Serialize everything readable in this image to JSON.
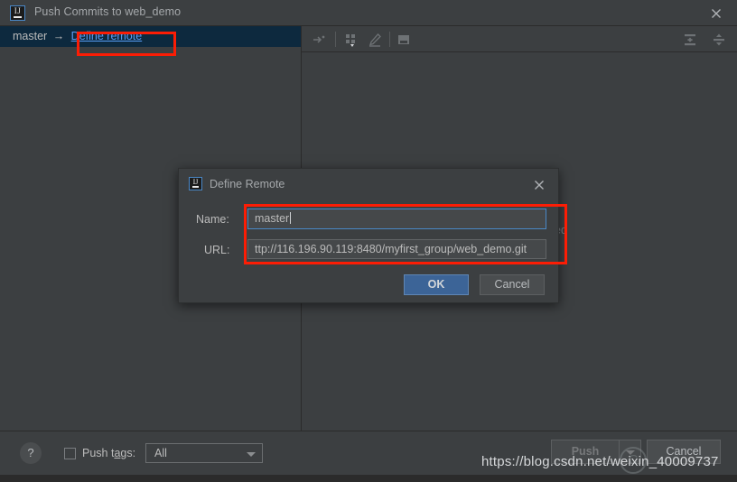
{
  "window": {
    "title": "Push Commits to web_demo",
    "logo_text": "IJ",
    "close_icon": "close-icon"
  },
  "toolbar": {
    "icons": [
      {
        "name": "collapse-arrow-icon",
        "label": ""
      },
      {
        "name": "grid-dropdown-icon",
        "label": ""
      },
      {
        "name": "edit-pencil-icon",
        "label": ""
      },
      {
        "name": "diff-view-icon",
        "label": ""
      },
      {
        "name": "expand-all-icon",
        "label": ""
      },
      {
        "name": "collapse-all-icon",
        "label": ""
      }
    ]
  },
  "left_pane": {
    "branch_row": {
      "source_branch": "master",
      "arrow": "→",
      "target_link": "Define remote"
    }
  },
  "right_pane": {
    "partial_commit_text": "ed"
  },
  "bottom_bar": {
    "help_label": "?",
    "push_tags_label_pre": "Push t",
    "push_tags_label_mnemonic": "a",
    "push_tags_label_post": "gs:",
    "push_tags_checked": false,
    "tags_combo_value": "All",
    "push_label": "Push",
    "push_dropdown": "chevron-down-icon",
    "cancel_label": "Cancel"
  },
  "modal": {
    "title": "Define Remote",
    "logo_text": "IJ",
    "close_icon": "close-icon",
    "name_label": "Name:",
    "name_value": "master",
    "url_label": "URL:",
    "url_value": "ttp://116.196.90.119:8480/myfirst_group/web_demo.git",
    "ok_label": "OK",
    "cancel_label": "Cancel"
  },
  "annotations": {
    "highlight_color": "#fc1d05",
    "boxes": [
      "define-remote-link",
      "name-and-url-fields"
    ]
  },
  "watermark": {
    "text": "https://blog.csdn.net/weixin_40009737",
    "logo_glyph": "C"
  },
  "colors": {
    "window_bg": "#3c3f41",
    "selection_bg": "#0d293e",
    "link": "#589df6",
    "accent_button": "#3c6497",
    "focus_border": "#4a88c7",
    "annotation": "#fc1d05"
  }
}
